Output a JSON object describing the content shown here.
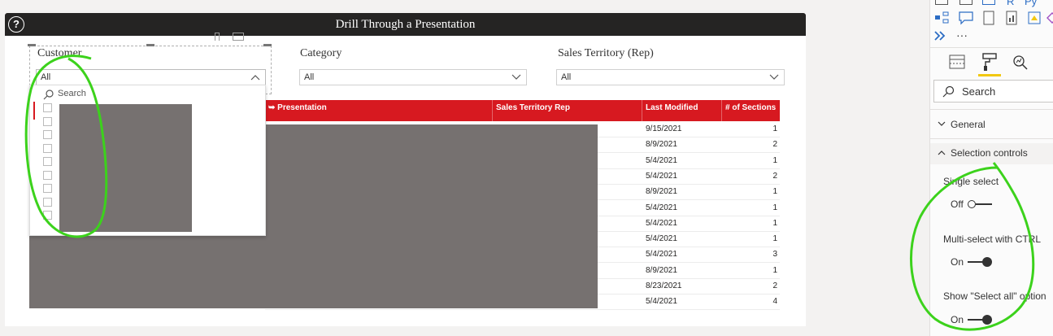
{
  "report": {
    "title": "Drill Through a Presentation",
    "help_icon": "question-icon"
  },
  "slicers": {
    "customer": {
      "title": "Customer",
      "value": "All",
      "search_placeholder": "Search"
    },
    "category": {
      "title": "Category",
      "value": "All"
    },
    "territory": {
      "title": "Sales Territory (Rep)",
      "value": "All"
    }
  },
  "table": {
    "columns": [
      "➥ Presentation",
      "Sales Territory Rep",
      "Last Modified",
      "# of Sections"
    ],
    "rows": [
      {
        "date": "9/15/2021",
        "sections": "1"
      },
      {
        "date": "8/9/2021",
        "sections": "2"
      },
      {
        "date": "5/4/2021",
        "sections": "1"
      },
      {
        "date": "5/4/2021",
        "sections": "2"
      },
      {
        "date": "8/9/2021",
        "sections": "1"
      },
      {
        "date": "5/4/2021",
        "sections": "1"
      },
      {
        "date": "5/4/2021",
        "sections": "1"
      },
      {
        "date": "5/4/2021",
        "sections": "1"
      },
      {
        "date": "5/4/2021",
        "sections": "3"
      },
      {
        "date": "8/9/2021",
        "sections": "1"
      },
      {
        "date": "8/23/2021",
        "sections": "2"
      },
      {
        "date": "5/4/2021",
        "sections": "4"
      }
    ]
  },
  "format_pane": {
    "search_placeholder": "Search",
    "sections": {
      "general": "General",
      "selection_controls": "Selection controls"
    },
    "single_select": {
      "label": "Single select",
      "state": "Off"
    },
    "multi_select": {
      "label": "Multi-select with CTRL",
      "state": "On"
    },
    "select_all": {
      "label": "Show \"Select all\" option",
      "state": "On"
    },
    "more": "···"
  },
  "colors": {
    "header_red": "#d71920",
    "annotation_green": "#3cd21c",
    "redaction_gray": "#767170",
    "format_accent": "#f2c811"
  }
}
